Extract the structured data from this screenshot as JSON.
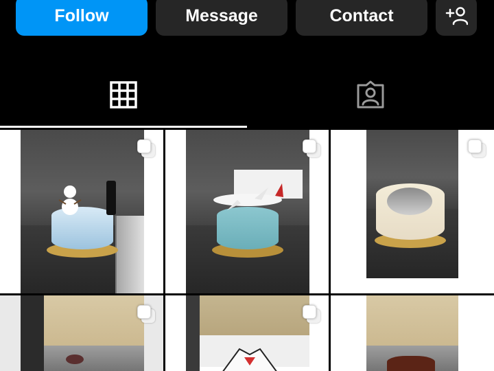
{
  "actions": {
    "follow_label": "Follow",
    "message_label": "Message",
    "contact_label": "Contact",
    "add_user_icon": "person-plus-icon"
  },
  "tabs": [
    {
      "name": "posts-grid",
      "icon": "grid-icon",
      "selected": true
    },
    {
      "name": "tagged",
      "icon": "tagged-person-icon",
      "selected": false
    }
  ],
  "grid": {
    "posts": [
      {
        "subject": "frozen-snowman-cake",
        "multiple": true
      },
      {
        "subject": "airplane-cake",
        "multiple": true
      },
      {
        "subject": "photo-portrait-music-cake",
        "multiple": true
      },
      {
        "subject": "cake-with-figures",
        "multiple": true
      },
      {
        "subject": "superman-shirt-cake",
        "multiple": true
      },
      {
        "subject": "chocolate-cake",
        "multiple": false
      }
    ]
  },
  "colors": {
    "background": "#000000",
    "follow_button": "#0095f6",
    "secondary_button": "#262626",
    "text": "#ffffff"
  }
}
